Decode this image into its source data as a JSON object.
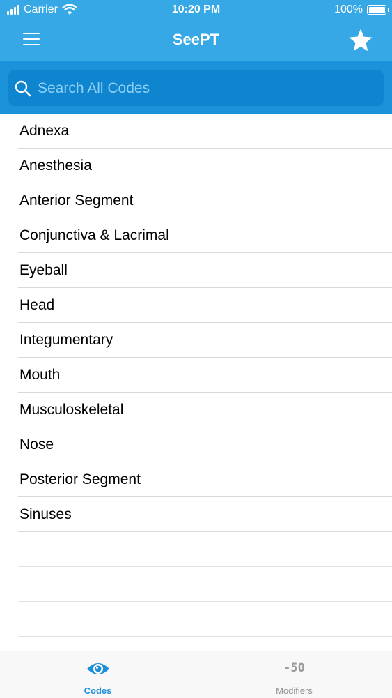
{
  "status_bar": {
    "carrier": "Carrier",
    "time": "10:20 PM",
    "battery": "100%"
  },
  "nav": {
    "title": "SeePT",
    "menu_icon": "hamburger-icon",
    "favorite_icon": "star-icon"
  },
  "search": {
    "placeholder": "Search All Codes",
    "value": ""
  },
  "categories": [
    "Adnexa",
    "Anesthesia",
    "Anterior Segment",
    "Conjunctiva & Lacrimal",
    "Eyeball",
    "Head",
    "Integumentary",
    "Mouth",
    "Musculoskeletal",
    "Nose",
    "Posterior Segment",
    "Sinuses"
  ],
  "tab_bar": {
    "codes_label": "Codes",
    "modifiers_label": "Modifiers",
    "modifiers_icon_text": "-50"
  },
  "colors": {
    "nav_background": "#36a8e6",
    "search_background": "#1b92d9",
    "active_tab": "#1f8fd8"
  }
}
